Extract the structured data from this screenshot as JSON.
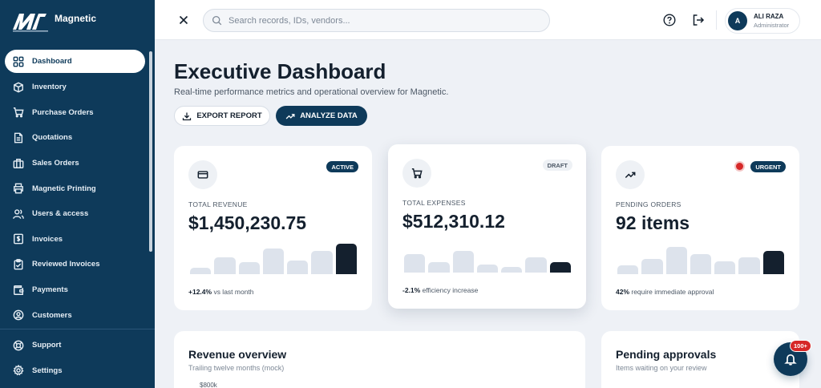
{
  "brand": {
    "name": "Magnetic",
    "logo_text": "MAGNETIC"
  },
  "nav": {
    "items": [
      {
        "label": "Dashboard",
        "icon": "grid-icon",
        "active": true
      },
      {
        "label": "Inventory",
        "icon": "box-icon"
      },
      {
        "label": "Purchase Orders",
        "icon": "cart-icon"
      },
      {
        "label": "Quotations",
        "icon": "document-icon"
      },
      {
        "label": "Sales Orders",
        "icon": "briefcase-icon"
      },
      {
        "label": "Magnetic Printing",
        "icon": "printer-icon"
      },
      {
        "label": "Users & access",
        "icon": "users-icon"
      },
      {
        "label": "Invoices",
        "icon": "invoice-icon"
      },
      {
        "label": "Reviewed Invoices",
        "icon": "clipboard-check-icon"
      },
      {
        "label": "Payments",
        "icon": "wallet-icon"
      },
      {
        "label": "Customers",
        "icon": "user-circle-icon"
      }
    ],
    "bottom": [
      {
        "label": "Support",
        "icon": "lifebuoy-icon"
      },
      {
        "label": "Settings",
        "icon": "gear-icon"
      }
    ]
  },
  "topbar": {
    "search_placeholder": "Search records, IDs, vendors...",
    "user_initial": "A",
    "user_name": "ALI RAZA",
    "user_role": "Administrator"
  },
  "header": {
    "title": "Executive Dashboard",
    "subtitle": "Real-time performance metrics and operational overview for Magnetic.",
    "export_label": "EXPORT REPORT",
    "analyze_label": "ANALYZE DATA"
  },
  "kpis": [
    {
      "badge": "ACTIVE",
      "label": "TOTAL REVENUE",
      "value": "$1,450,230.75",
      "foot_value": "+12.4%",
      "foot_text": " vs last month",
      "bars": [
        0.2,
        0.55,
        0.4,
        0.85,
        0.45,
        0.75,
        1.0
      ]
    },
    {
      "badge": "DRAFT",
      "label": "TOTAL EXPENSES",
      "value": "$512,310.12",
      "foot_value": "-2.1%",
      "foot_text": " efficiency increase",
      "bars": [
        0.6,
        0.35,
        0.7,
        0.25,
        0.18,
        0.5,
        0.33
      ]
    },
    {
      "badge": "URGENT",
      "label": "PENDING ORDERS",
      "value": "92 items",
      "foot_value": "42%",
      "foot_text": " require immediate approval",
      "bars": [
        0.3,
        0.5,
        0.9,
        0.65,
        0.42,
        0.55,
        0.75
      ]
    }
  ],
  "revenue_panel": {
    "title": "Revenue overview",
    "subtitle": "Trailing twelve months (mock)",
    "first_tick": "$800k"
  },
  "approvals_panel": {
    "title": "Pending approvals",
    "subtitle": "Items waiting on your review"
  },
  "notifications": {
    "count": "100+"
  },
  "colors": {
    "sidebar": "#0e3a5a",
    "accent": "#0e3a5a",
    "urgent": "#d62828",
    "bar": "#dde3ec",
    "bar_highlight": "#14202e"
  }
}
